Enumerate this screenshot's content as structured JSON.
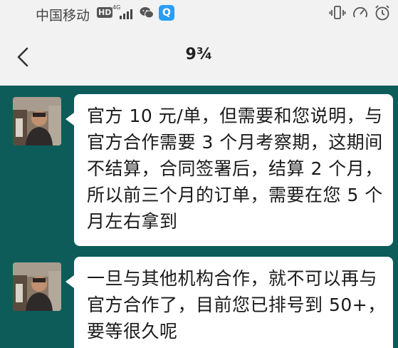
{
  "status_bar": {
    "carrier": "中国移动",
    "hd_badge": "HD",
    "network_type": "4G",
    "qq_label": "Q",
    "icons": [
      "hd-icon",
      "signal-icon",
      "wechat-icon",
      "qq-icon",
      "vibrate-icon",
      "speed-icon",
      "alarm-icon"
    ]
  },
  "header": {
    "title": "9¾",
    "back_icon": "chevron-left-icon"
  },
  "messages": [
    {
      "sender": "other",
      "text": "官方 10 元/单，但需要和您说明，与官方合作需要 3 个月考察期，这期间不结算，合同签署后，结算 2 个月，所以前三个月的订单，需要在您 5 个月左右拿到"
    },
    {
      "sender": "other",
      "text": "一旦与其他机构合作，就不可以再与官方合作了，目前您已排号到 50+，要等很久呢"
    }
  ],
  "colors": {
    "chat_background": "#0d5c5a",
    "bubble_background": "#ffffff",
    "header_background": "#f2f2f2"
  }
}
